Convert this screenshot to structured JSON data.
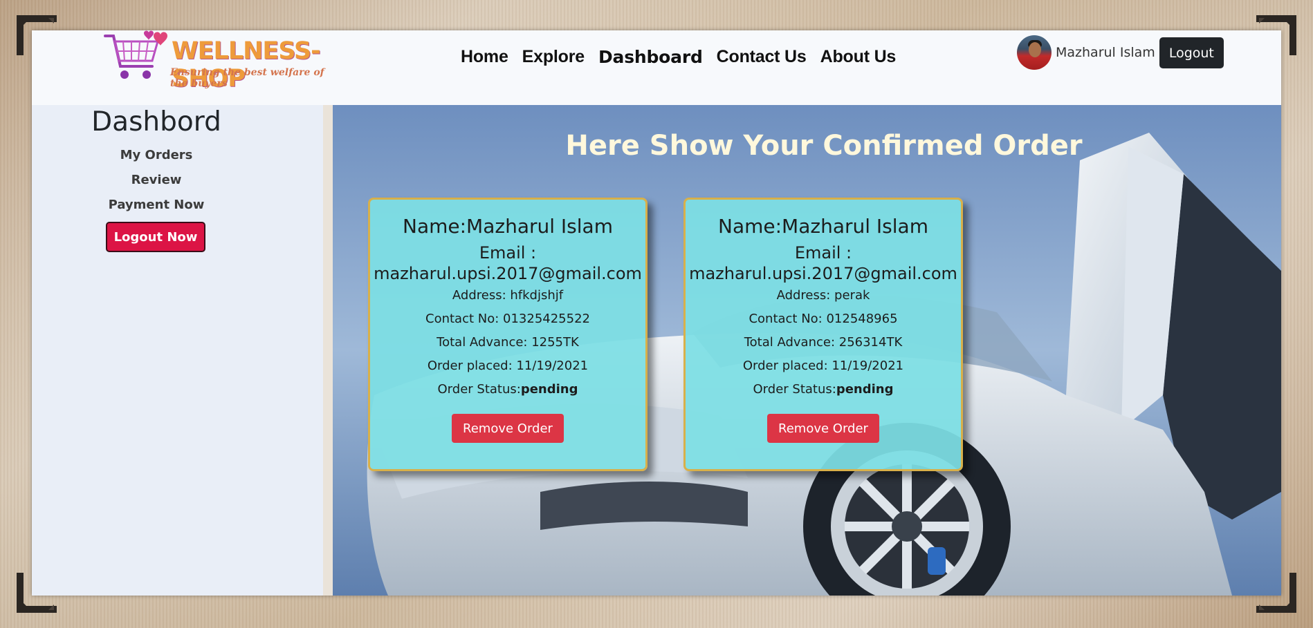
{
  "brand": {
    "name": "WELLNESS-SHOP",
    "tagline": "Ensuring the best welfare of the buyers",
    "logo_icon": "shopping-cart-heart-icon"
  },
  "nav": {
    "links": [
      "Home",
      "Explore",
      "Dashboard",
      "Contact Us",
      "About Us"
    ],
    "active": "Dashboard"
  },
  "user": {
    "name": "Mazharul Islam",
    "logout_label": "Logout"
  },
  "sidebar": {
    "title": "Dashbord",
    "items": [
      "My Orders",
      "Review",
      "Payment Now"
    ],
    "logout_now_label": "Logout Now"
  },
  "main": {
    "title": "Here Show Your Confirmed Order",
    "orders": [
      {
        "name": "Name:Mazharul Islam",
        "email_label": "Email :",
        "email": "mazharul.upsi.2017@gmail.com",
        "address": "Address: hfkdjshjf",
        "contact": "Contact No: 01325425522",
        "advance": "Total Advance: 1255TK",
        "placed": "Order placed: 11/19/2021",
        "status_label": "Order Status:",
        "status": "pending",
        "remove_label": "Remove Order"
      },
      {
        "name": "Name:Mazharul Islam",
        "email_label": "Email :",
        "email": "mazharul.upsi.2017@gmail.com",
        "address": "Address: perak",
        "contact": "Contact No: 012548965",
        "advance": "Total Advance: 256314TK",
        "placed": "Order placed: 11/19/2021",
        "status_label": "Order Status:",
        "status": "pending",
        "remove_label": "Remove Order"
      }
    ]
  },
  "colors": {
    "card_bg": "#7ddfe4",
    "card_border": "#d8b04a",
    "danger": "#dc3545",
    "logout_now": "#dc1445",
    "title": "#fff8dc",
    "dark_button": "#212529"
  }
}
